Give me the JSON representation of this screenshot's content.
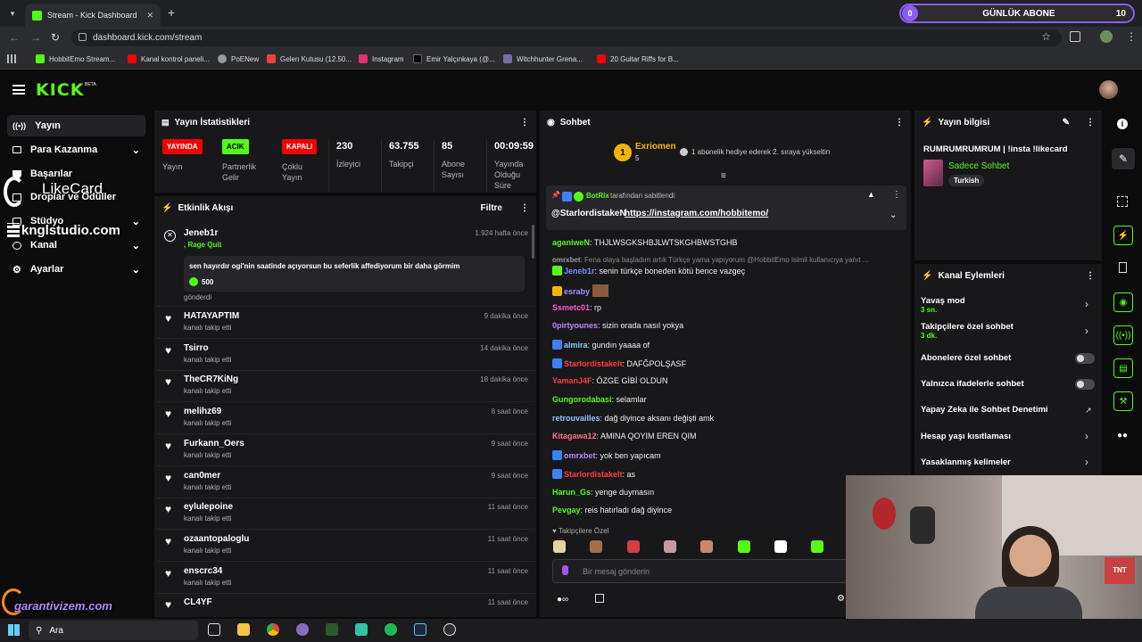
{
  "browser": {
    "tab_title": "Stream - Kick Dashboard",
    "url": "dashboard.kick.com/stream",
    "bookmarks": [
      "HobbitEmo Stream...",
      "Kanal kontrol paneli...",
      "PoENew",
      "Gelen Kutusu (12.50...",
      "Instagram",
      "Emir Yalçınkaya (@...",
      "Witchhunter Grena...",
      "20 Guitar Riffs for B..."
    ],
    "abone": {
      "count": "0",
      "label": "GÜNLÜK ABONE",
      "target": "10",
      "accent": "#8b5cf6"
    }
  },
  "brand": {
    "logo": "KICK",
    "beta": "BETA",
    "green": "#53fc18"
  },
  "sidebar": {
    "items": [
      {
        "label": "Yayın",
        "icon": "broadcast-icon"
      },
      {
        "label": "Para Kazanma",
        "icon": "money-icon"
      },
      {
        "label": "Başarılar",
        "icon": "trophy-icon"
      },
      {
        "label": "Droplar ve Ödüller",
        "icon": "gift-icon"
      },
      {
        "label": "Stüdyo",
        "icon": "studio-icon"
      },
      {
        "label": "Kanal",
        "icon": "channel-icon"
      },
      {
        "label": "Ayarlar",
        "icon": "gear-icon"
      }
    ],
    "overlay_likecard": "LikeCard",
    "overlay_kngl": "knglstudio.com",
    "overlay_garanti": "garantivizem.com"
  },
  "stats": {
    "title": "Yayın İstatistikleri",
    "items": [
      {
        "badge": "YAYINDA",
        "label": "Yayın",
        "color": "#eb0400"
      },
      {
        "badge": "ACIK",
        "label": "Partnerlik Gelir",
        "color": "#53fc18"
      },
      {
        "badge": "KAPALI",
        "label": "Çoklu Yayın",
        "color": "#eb0400"
      },
      {
        "value": "230",
        "label": "İzleyici"
      },
      {
        "value": "63.755",
        "label": "Takipçi"
      },
      {
        "value": "85",
        "label": "Abone Sayısı"
      },
      {
        "value": "00:09:59",
        "label": "Yayında Olduğu Süre"
      }
    ]
  },
  "activity": {
    "title": "Etkinlik Akışı",
    "filter": "Filtre",
    "gift": {
      "user": "Jeneb1r",
      "badge": ", Rage Quit",
      "time": "1.924 hafta önce",
      "message": "sen hayırdır ogi'nin saatinde açıyorsun bu seferlik affediyorum bir daha görmim",
      "amount": "500",
      "sent": "gönderdi"
    },
    "follows": [
      {
        "user": "HATAYAPTIM",
        "text": "kanalı takip etti",
        "time": "9 dakika önce"
      },
      {
        "user": "Tsirro",
        "text": "kanalı takip etti",
        "time": "14 dakika önce"
      },
      {
        "user": "TheCR7KiNg",
        "text": "kanalı takip etti",
        "time": "18 dakika önce"
      },
      {
        "user": "melihz69",
        "text": "kanalı takip etti",
        "time": "8 saat önce"
      },
      {
        "user": "Furkann_Oers",
        "text": "kanalı takip etti",
        "time": "9 saat önce"
      },
      {
        "user": "can0mer",
        "text": "kanalı takip etti",
        "time": "9 saat önce"
      },
      {
        "user": "eylulepoine",
        "text": "kanalı takip etti",
        "time": "11 saat önce"
      },
      {
        "user": "ozaantopaloglu",
        "text": "kanalı takip etti",
        "time": "11 saat önce"
      },
      {
        "user": "enscrc34",
        "text": "kanalı takip etti",
        "time": "11 saat önce"
      },
      {
        "user": "CL4YF",
        "text": "",
        "time": "11 saat önce"
      }
    ]
  },
  "chat": {
    "title": "Sohbet",
    "top_gifter": {
      "name": "Exriomen",
      "count": "5",
      "rank": "1",
      "text": "1 abonelik hediye ederek 2. sıraya yükseltin"
    },
    "pinned": {
      "by": "BotRix",
      "suffix": "tarafından sabitlendi",
      "mention": "@StarlordistakeN",
      "link": "https://instagram.com/hobbitemo/"
    },
    "messages": [
      {
        "user": "aganiweN",
        "color": "#53fc18",
        "text": "THJLWSGKSHBJLWTSKGHBWSTGHB"
      },
      {
        "user": "omrxbet",
        "color": "#9a9a9a",
        "text": "Fena olaya başladım artık Türkçe yama yapıyorum @HobbitEmo isimli kullanıcıya yanıt ..."
      },
      {
        "user": "Jeneb1r",
        "color": "#7c8cff",
        "text": "senin türkçe boneden kötü bence vazgeç"
      },
      {
        "user": "esraby",
        "color": "#a78bfa",
        "text": ""
      },
      {
        "user": "Ssmetc01",
        "color": "#ff5ac8",
        "text": "rp"
      },
      {
        "user": "0pirtyounes",
        "color": "#c084fc",
        "text": "sizin orada nasıl yokya"
      },
      {
        "user": "almira",
        "color": "#7dd3fc",
        "text": "gundın yaaaa of"
      },
      {
        "user": "Starlordistakelt",
        "color": "#ff3b3b",
        "text": "DAFĞPOLŞASF"
      },
      {
        "user": "YamanJ4F",
        "color": "#ff3b3b",
        "text": "ÖZGE GİBİ OLDUN"
      },
      {
        "user": "Gungorodabasi",
        "color": "#53fc18",
        "text": "selamlar"
      },
      {
        "user": "retrouvailles",
        "color": "#93c5fd",
        "text": "dağ diyince aksanı değişti amk"
      },
      {
        "user": "Kitagawa12",
        "color": "#fb7185",
        "text": "AMINA QOYIM EREN QIM"
      },
      {
        "user": "omrxbet",
        "color": "#c084fc",
        "text": "yok ben yapıcam"
      },
      {
        "user": "Starlordistakelt",
        "color": "#ff3b3b",
        "text": "as"
      },
      {
        "user": "Harun_Gs",
        "color": "#53fc18",
        "text": "yenge duymasın"
      },
      {
        "user": "Pevgay",
        "color": "#53fc18",
        "text": "reis hatırladı dağ diyince"
      }
    ],
    "followers_only": "Takipçilere Özel",
    "input_placeholder": "Bir mesaj gönderin"
  },
  "stream_info": {
    "title": "Yayın bilgisi",
    "stream_title": "RUMRUMRUMRUM | !insta !likecard",
    "category": "Sadece Sohbet",
    "language": "Turkish"
  },
  "channel_actions": {
    "title": "Kanal Eylemleri",
    "items": [
      {
        "label": "Yavaş mod",
        "sub": "3 sn.",
        "kind": "chevron"
      },
      {
        "label": "Takipçilere özel sohbet",
        "sub": "3 dk.",
        "kind": "chevron"
      },
      {
        "label": "Abonelere özel sohbet",
        "sub": "",
        "kind": "toggle"
      },
      {
        "label": "Yalnızca ifadelerle sohbet",
        "sub": "",
        "kind": "toggle"
      },
      {
        "label": "Yapay Zeka ile Sohbet Denetimi",
        "sub": "",
        "kind": "external"
      },
      {
        "label": "Hesap yaşı kısıtlaması",
        "sub": "",
        "kind": "chevron"
      },
      {
        "label": "Yasaklanmış kelimeler",
        "sub": "",
        "kind": "chevron"
      }
    ]
  },
  "taskbar": {
    "search": "Ara"
  }
}
